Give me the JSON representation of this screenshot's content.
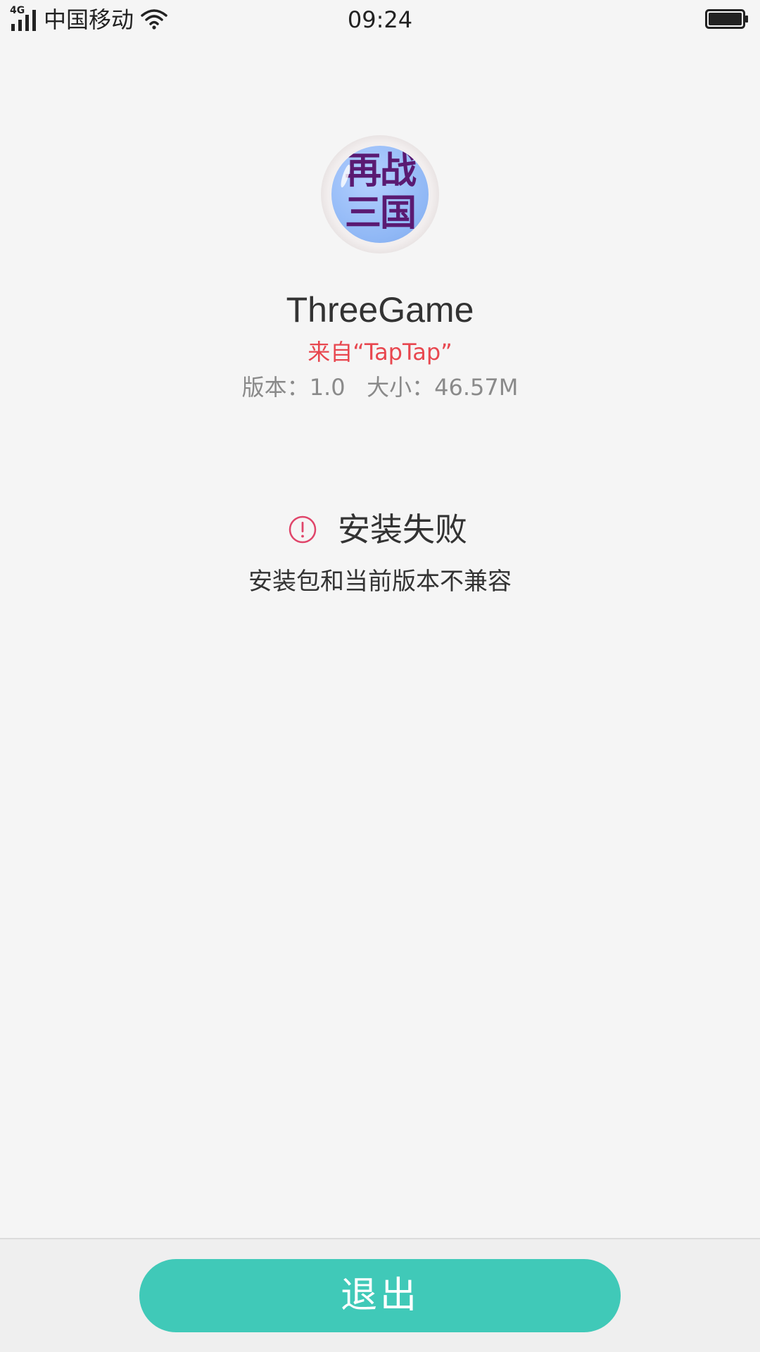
{
  "status_bar": {
    "network_type": "4G",
    "carrier": "中国移动",
    "time": "09:24",
    "icons": [
      "signal-icon",
      "wifi-icon",
      "battery-icon"
    ]
  },
  "app": {
    "icon_text": "再战三国",
    "name": "ThreeGame",
    "source": "来自“TapTap”",
    "version_label": "版本：",
    "version": "1.0",
    "size_label": "大小：",
    "size": "46.57M"
  },
  "result": {
    "icon": "error-circle-icon",
    "title": "安装失败",
    "message": "安装包和当前版本不兼容"
  },
  "footer": {
    "exit_label": "退出"
  },
  "colors": {
    "background": "#f5f5f5",
    "accent": "#40c9b8",
    "source_text": "#e8474f",
    "error_icon": "#e0456a"
  }
}
